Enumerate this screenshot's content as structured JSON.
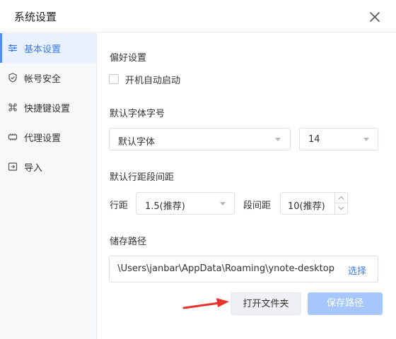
{
  "window": {
    "title": "系统设置"
  },
  "sidebar": {
    "items": [
      {
        "label": "基本设置",
        "icon": "sliders-icon",
        "active": true
      },
      {
        "label": "帐号安全",
        "icon": "shield-icon",
        "active": false
      },
      {
        "label": "快捷键设置",
        "icon": "command-icon",
        "active": false
      },
      {
        "label": "代理设置",
        "icon": "proxy-icon",
        "active": false
      },
      {
        "label": "导入",
        "icon": "import-icon",
        "active": false
      }
    ]
  },
  "preferences": {
    "title": "偏好设置",
    "autostart_label": "开机自动启动",
    "autostart_checked": false
  },
  "font": {
    "title": "默认字体字号",
    "family_value": "默认字体",
    "size_value": "14"
  },
  "spacing": {
    "title": "默认行距段间距",
    "line_label": "行距",
    "line_value": "1.5(推荐)",
    "paragraph_label": "段间距",
    "paragraph_value": "10(推荐)"
  },
  "storage": {
    "title": "储存路径",
    "path_value": "C:\\Users\\janbar\\AppData\\Roaming\\ynote-desktop",
    "choose_label": "选择",
    "open_folder_label": "打开文件夹",
    "save_path_label": "保存路径"
  },
  "colors": {
    "accent": "#3b7cf5",
    "active_bg": "#e9f1fe",
    "save_button_disabled": "#a6c7fb",
    "annotation_arrow": "#e8332a"
  }
}
